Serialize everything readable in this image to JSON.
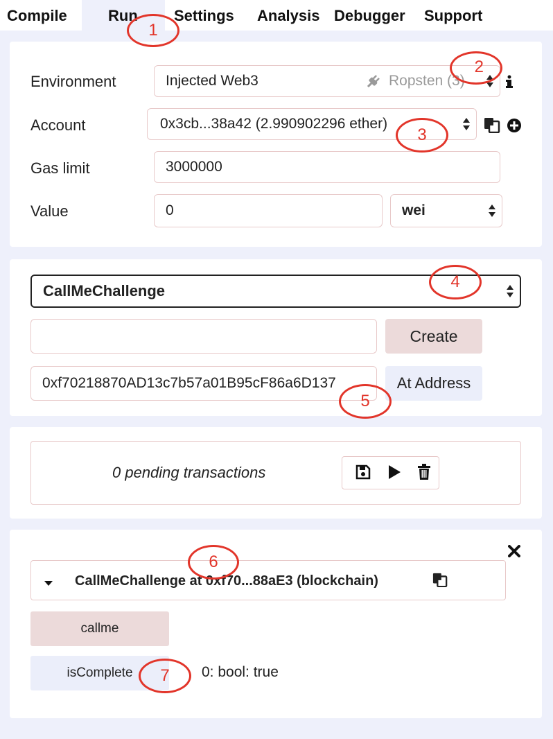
{
  "tabs": [
    "Compile",
    "Run",
    "Settings",
    "Analysis",
    "Debugger",
    "Support"
  ],
  "run_panel": {
    "environment_label": "Environment",
    "environment_value": "Injected Web3",
    "network_label": "Ropsten (3)",
    "account_label": "Account",
    "account_value": "0x3cb...38a42 (2.990902296 ether)",
    "gas_label": "Gas limit",
    "gas_value": "3000000",
    "value_label": "Value",
    "value_amount": "0",
    "value_unit": "wei"
  },
  "contract_panel": {
    "selected_contract": "CallMeChallenge",
    "create_label": "Create",
    "address_value": "0xf70218870AD13c7b57a01B95cF86a6D137",
    "at_address_label": "At Address"
  },
  "pending_panel": {
    "text": "0 pending transactions"
  },
  "instance_panel": {
    "title": "CallMeChallenge at 0xf70...88aE3 (blockchain)",
    "callme_label": "callme",
    "iscomplete_label": "isComplete",
    "iscomplete_result": "0: bool: true"
  },
  "annotations": [
    "1",
    "2",
    "3",
    "4",
    "5",
    "6",
    "7"
  ],
  "colors": {
    "background": "#eef0fb",
    "annotation": "#e2352a",
    "create_button": "#ecdada",
    "at_address_button": "#ebeefa"
  },
  "icons": [
    "plug-icon",
    "info-icon",
    "copy-icon",
    "plus-circle-icon",
    "save-icon",
    "play-icon",
    "trash-icon",
    "caret-down-icon",
    "close-icon"
  ]
}
